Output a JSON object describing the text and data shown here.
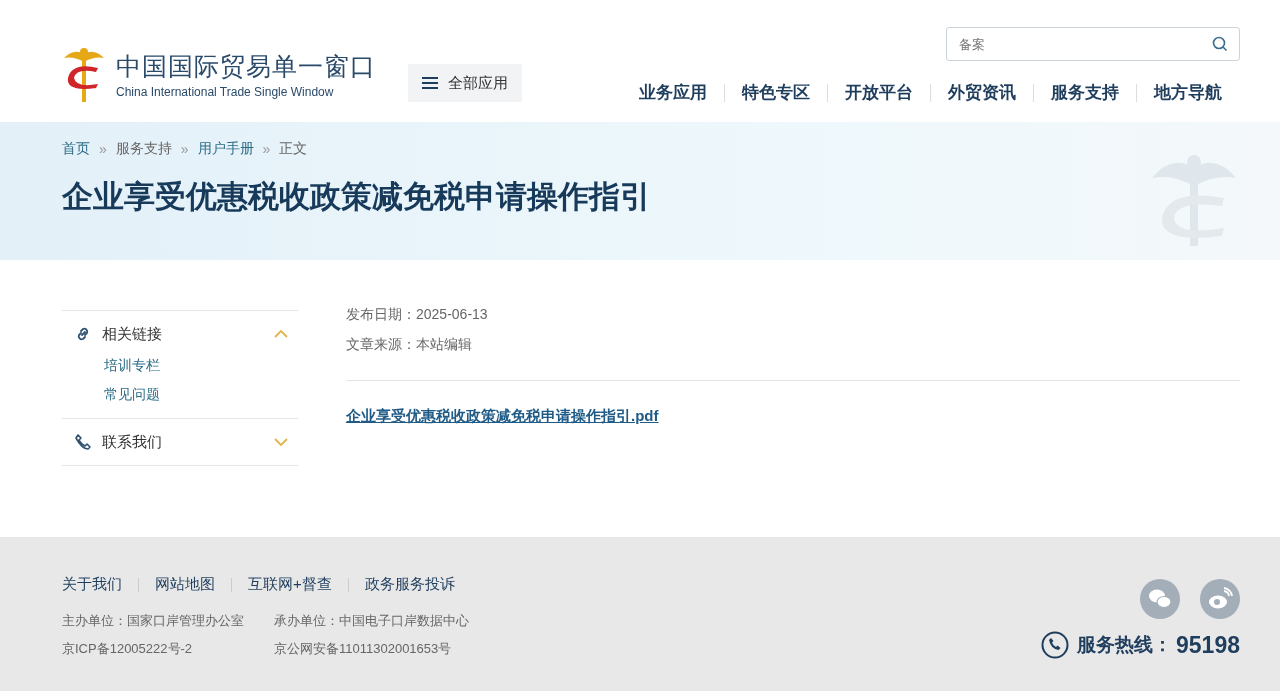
{
  "header": {
    "logo_title": "中国国际贸易单一窗口",
    "logo_subtitle": "China International Trade Single Window",
    "all_apps": "全部应用",
    "search": {
      "placeholder": "备案"
    },
    "nav": [
      "业务应用",
      "特色专区",
      "开放平台",
      "外贸资讯",
      "服务支持",
      "地方导航"
    ]
  },
  "banner": {
    "breadcrumb": [
      {
        "label": "首页",
        "kind": "link"
      },
      {
        "label": "服务支持",
        "kind": "text"
      },
      {
        "label": "用户手册",
        "kind": "link"
      },
      {
        "label": "正文",
        "kind": "text"
      }
    ],
    "separator": "»",
    "title": "企业享受优惠税收政策减免税申请操作指引"
  },
  "sidebar": [
    {
      "label": "相关链接",
      "kind": "link",
      "expanded": true,
      "children": [
        "培训专栏",
        "常见问题"
      ]
    },
    {
      "label": "联系我们",
      "kind": "phone",
      "expanded": false
    }
  ],
  "article": {
    "meta": [
      "发布日期：2025-06-13",
      "文章来源：本站编辑"
    ],
    "attachment": "企业享受优惠税收政策减免税申请操作指引.pdf"
  },
  "footer": {
    "links": [
      "关于我们",
      "网站地图",
      "互联网+督查",
      "政务服务投诉"
    ],
    "info": [
      [
        "主办单位：国家口岸管理办公室",
        "京ICP备12005222号-2"
      ],
      [
        "承办单位：中国电子口岸数据中心",
        "京公网安备11011302001653号"
      ]
    ],
    "hotline_label": "服务热线：",
    "hotline_number": "95198"
  }
}
